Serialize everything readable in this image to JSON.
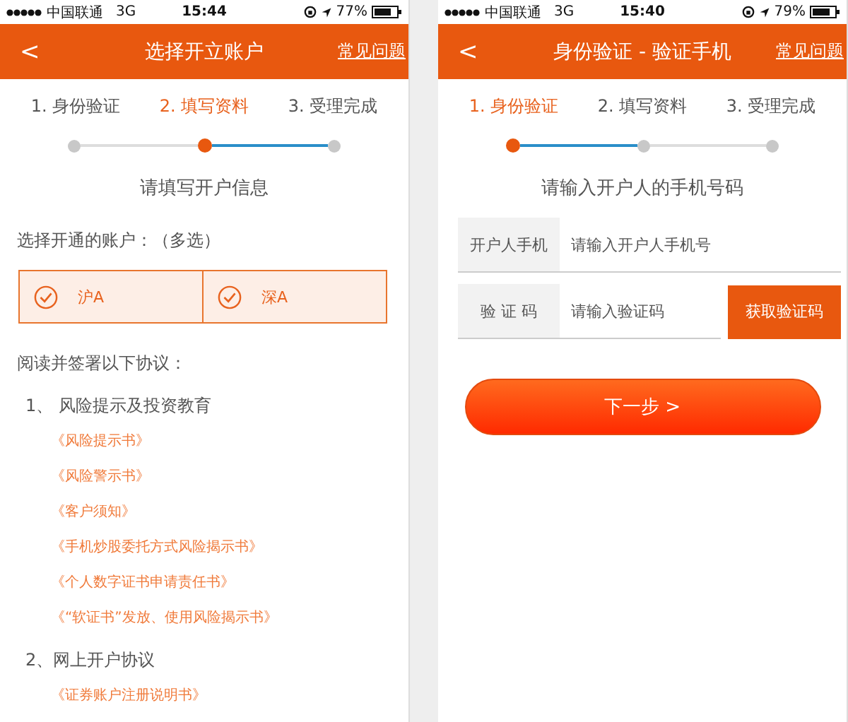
{
  "screens": [
    {
      "kind": "accounts",
      "status": {
        "carrier": "中国联通",
        "network": "3G",
        "time": "15:44",
        "battery": "77%"
      },
      "header": {
        "back": "<",
        "title": "选择开立账户",
        "help": "常见问题"
      },
      "steps": [
        {
          "label": "1. 身份验证",
          "selected": false
        },
        {
          "label": "2. 填写资料",
          "selected": true
        },
        {
          "label": "3. 受理完成",
          "selected": false
        }
      ],
      "prompt": "请填写开户信息",
      "accounts_label": "选择开通的账户：（多选）",
      "accounts": [
        {
          "label": "沪A",
          "checked": true
        },
        {
          "label": "深A",
          "checked": true
        }
      ],
      "agreements_label": "阅读并签署以下协议：",
      "agreement_groups": [
        {
          "title": "1、 风险提示及投资教育",
          "links": [
            "《风险提示书》",
            "《风险警示书》",
            "《客户须知》",
            "《手机炒股委托方式风险揭示书》",
            "《个人数字证书申请责任书》",
            "《“软证书”发放、使用风险揭示书》"
          ]
        },
        {
          "title": "2、网上开户协议",
          "links": [
            "《证券账户注册说明书》"
          ]
        }
      ]
    },
    {
      "kind": "verify",
      "status": {
        "carrier": "中国联通",
        "network": "3G",
        "time": "15:40",
        "battery": "79%"
      },
      "header": {
        "back": "<",
        "title": "身份验证 - 验证手机",
        "help": "常见问题"
      },
      "steps": [
        {
          "label": "1. 身份验证",
          "selected": true
        },
        {
          "label": "2. 填写资料",
          "selected": false
        },
        {
          "label": "3. 受理完成",
          "selected": false
        }
      ],
      "prompt": "请输入开户人的手机号码",
      "fields": [
        {
          "label": "开户人手机",
          "placeholder": "请输入开户人手机号"
        },
        {
          "label": "验 证 码",
          "placeholder": "请输入验证码",
          "action": "获取验证码"
        }
      ],
      "next_button": "下一步 >"
    }
  ]
}
